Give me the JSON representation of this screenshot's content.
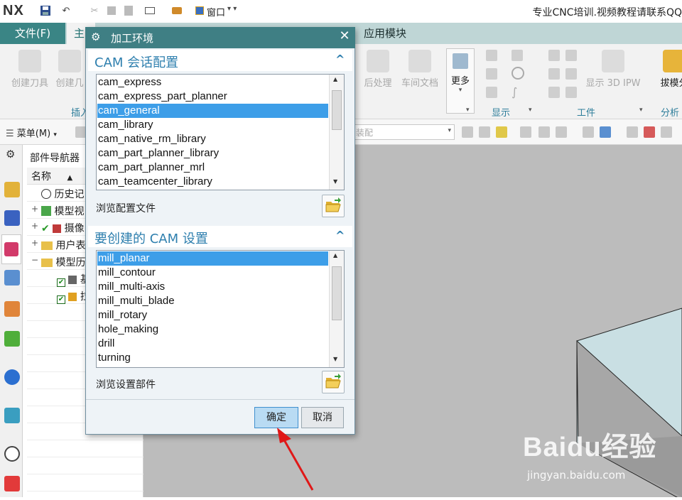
{
  "app": {
    "logo": "NX",
    "title": "专业CNC培训.视频教程请联系QQ",
    "window_menu": "窗口"
  },
  "ribbon": {
    "tabs": [
      "文件(F)",
      "主",
      "应用模块"
    ],
    "buttons": [
      {
        "label": "创建刀具",
        "icon": "create-tool-icon"
      },
      {
        "label": "创建几",
        "icon": "create-geometry-icon"
      },
      {
        "label": "后处理",
        "icon": "postprocess-icon"
      },
      {
        "label": "车间文档",
        "icon": "shop-doc-icon"
      },
      {
        "label": "更多",
        "icon": "more-icon"
      },
      {
        "label": "显示 3D IPW",
        "icon": "ipw-icon"
      },
      {
        "label": "拔模分",
        "icon": "draft-analysis-icon"
      }
    ],
    "groups": {
      "insert": "插入",
      "display": "显示",
      "workpiece": "工件",
      "analysis": "分析"
    }
  },
  "toolbar": {
    "menu": "菜单(M)",
    "filter_placeholder": "装配"
  },
  "navigator": {
    "title": "部件导航器",
    "column_name": "名称",
    "rows": [
      {
        "label": "历史记",
        "icon": "history-clock-icon",
        "indent": 0
      },
      {
        "label": "模型视",
        "icon": "model-views-icon",
        "indent": 0
      },
      {
        "label": "摄像",
        "icon": "camera-icon",
        "indent": 0
      },
      {
        "label": "用户表",
        "icon": "folder-icon",
        "indent": 0
      },
      {
        "label": "模型历",
        "icon": "folder-open-icon",
        "indent": 0
      },
      {
        "label": "基",
        "icon": "datum-csys-icon",
        "indent": 1
      },
      {
        "label": "拉",
        "icon": "extrude-icon",
        "indent": 1
      }
    ]
  },
  "dialog": {
    "title": "加工环境",
    "session_section": {
      "heading": "CAM 会话配置",
      "items": [
        "cam_express",
        "cam_express_part_planner",
        "cam_general",
        "cam_library",
        "cam_native_rm_library",
        "cam_part_planner_library",
        "cam_part_planner_mrl",
        "cam_teamcenter_library"
      ],
      "selected": "cam_general",
      "browse_label": "浏览配置文件"
    },
    "setup_section": {
      "heading": "要创建的 CAM 设置",
      "items": [
        "mill_planar",
        "mill_contour",
        "mill_multi-axis",
        "mill_multi_blade",
        "mill_rotary",
        "hole_making",
        "drill",
        "turning"
      ],
      "selected": "mill_planar",
      "browse_label": "浏览设置部件"
    },
    "ok_label": "确定",
    "cancel_label": "取消"
  },
  "watermark": {
    "brand": "Baidu经验",
    "url": "jingyan.baidu.com"
  },
  "colors": {
    "tab_file_bg": "#3a8585",
    "dialog_title_bg": "#3f7f84",
    "section_heading": "#2e7fae",
    "selection": "#3d9ee8",
    "arrow": "#e01818",
    "viewport_bg": "#bcbcbc",
    "solid_top": "#c9dfe3"
  }
}
